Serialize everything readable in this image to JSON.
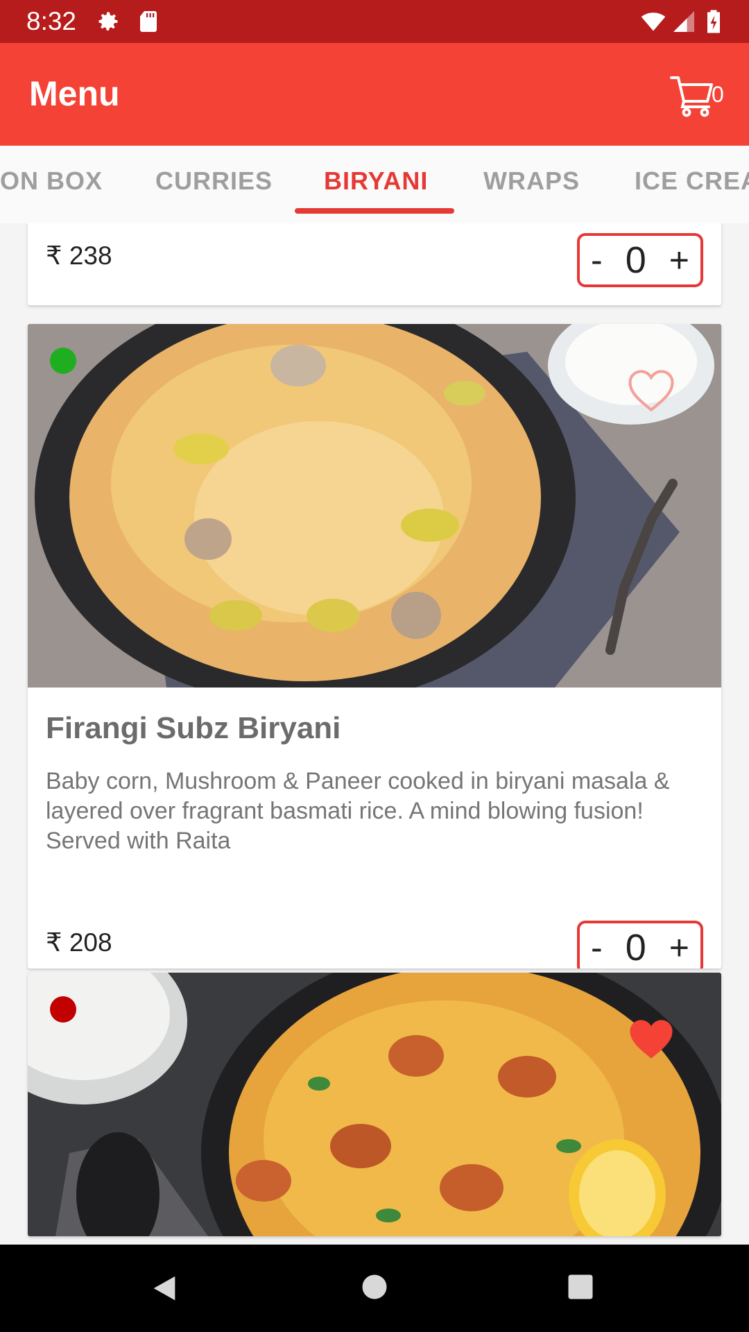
{
  "status_bar": {
    "time": "8:32"
  },
  "app_bar": {
    "title": "Menu",
    "cart_count": "0"
  },
  "tabs": [
    {
      "label": "ON BOX"
    },
    {
      "label": "CURRIES"
    },
    {
      "label": "BIRYANI"
    },
    {
      "label": "WRAPS"
    },
    {
      "label": "ICE CREA"
    }
  ],
  "active_tab": "BIRYANI",
  "items": [
    {
      "price": "₹ 238",
      "minus": "-",
      "qty": "0",
      "plus": "+"
    },
    {
      "name": "Firangi Subz Biryani",
      "description": "Baby corn, Mushroom & Paneer cooked in biryani masala & layered over fragrant basmati rice. A mind blowing fusion! Served with Raita",
      "price": "₹ 208",
      "minus": "-",
      "qty": "0",
      "plus": "+",
      "diet": "veg",
      "favorite": false
    },
    {
      "diet": "non-veg",
      "favorite": true
    }
  ],
  "colors": {
    "accent": "#f44336",
    "status": "#b71c1c",
    "veg": "#1fae1f",
    "nonveg": "#c20000"
  }
}
